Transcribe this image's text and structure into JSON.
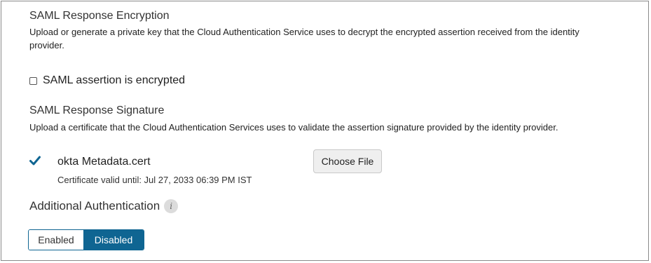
{
  "encryption": {
    "title": "SAML Response Encryption",
    "description": "Upload or generate a private key that the Cloud Authentication Service uses to decrypt the encrypted assertion received from the identity provider.",
    "checkbox_label": "SAML assertion is encrypted",
    "checked": false
  },
  "signature": {
    "title": "SAML Response Signature",
    "description": "Upload a certificate that the Cloud Authentication Services uses to validate the assertion signature provided by the identity provider.",
    "cert_name": "okta Metadata.cert",
    "cert_validity": "Certificate valid until: Jul 27, 2033 06:39 PM IST",
    "choose_file_label": "Choose File"
  },
  "additional_auth": {
    "title": "Additional Authentication",
    "info_icon": "i",
    "options": [
      "Enabled",
      "Disabled"
    ],
    "selected": "Disabled"
  },
  "colors": {
    "accent": "#0f6592"
  }
}
